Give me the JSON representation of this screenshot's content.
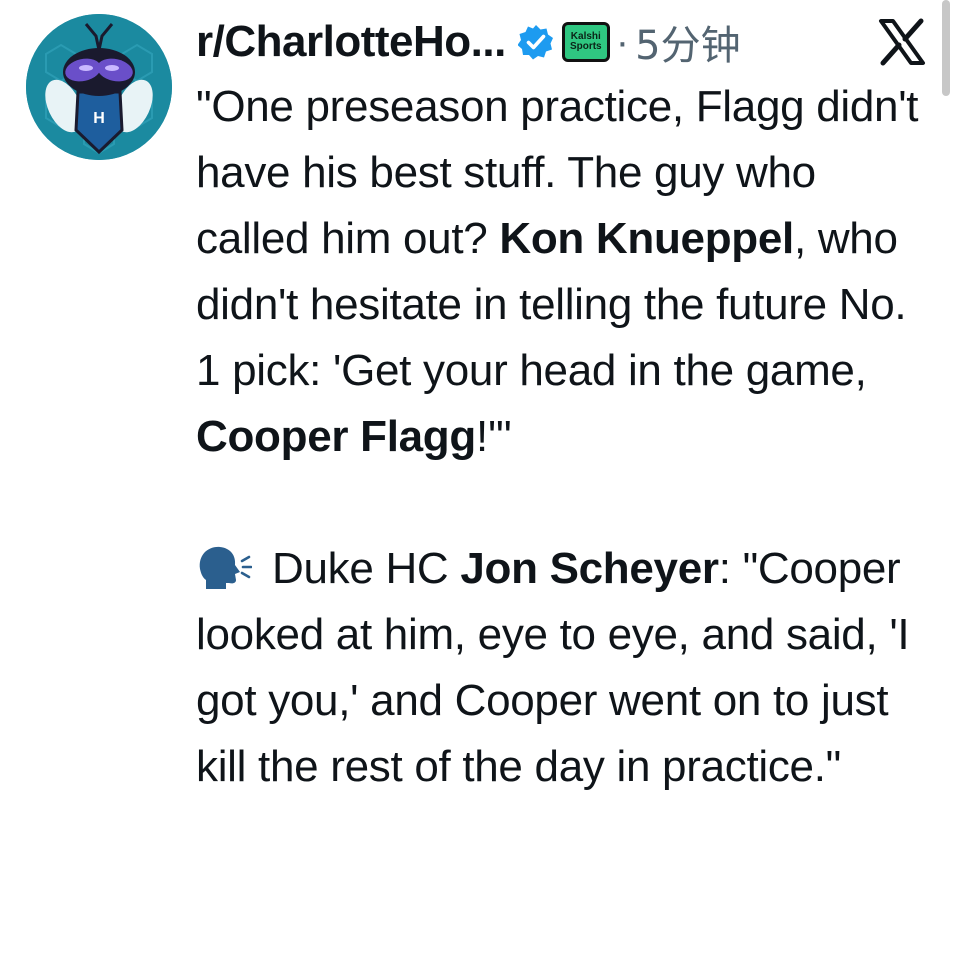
{
  "post": {
    "author": {
      "display_name": "r/CharlotteHo...",
      "verified_icon": "verified-badge-icon",
      "affiliate_badge": {
        "line1": "Kalshi",
        "line2": "Sports"
      },
      "separator": "·",
      "timestamp": "5分钟"
    },
    "platform_icon": "x-logo-icon",
    "paragraph1": {
      "part1": "\"One preseason practice, Flagg didn't have his best stuff. The guy who called him out? ",
      "bold1": "Kon Knueppel",
      "part2": ", who didn't hesitate in telling the future No. 1 pick: 'Get your head in the game, ",
      "bold2": "Cooper Flagg",
      "part3": "!'\""
    },
    "paragraph2": {
      "icon": "speaking-head-icon",
      "part1": "Duke HC ",
      "bold1": "Jon Scheyer",
      "part2": ": \"Cooper looked at him, eye to eye, and said, 'I got you,' and Cooper went on to just kill the rest of the day in practice.\""
    }
  },
  "colors": {
    "text": "#0f1419",
    "muted": "#536471",
    "verified": "#1d9bf0",
    "affiliate": "#2fc781",
    "avatar_bg": "#1b8aa0"
  }
}
